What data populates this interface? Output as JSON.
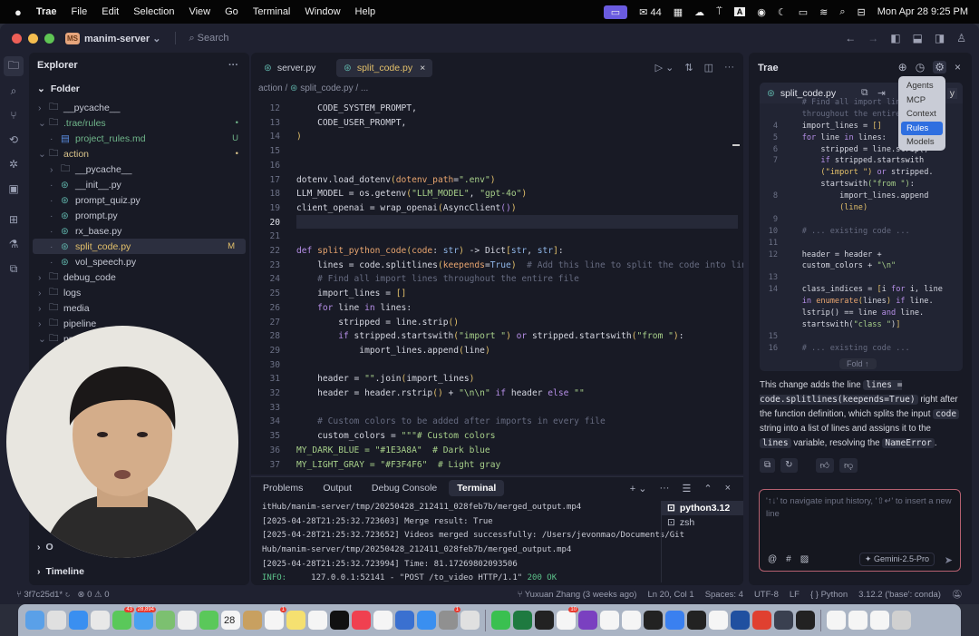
{
  "menubar": {
    "app": "Trae",
    "items": [
      "File",
      "Edit",
      "Selection",
      "View",
      "Go",
      "Terminal",
      "Window",
      "Help"
    ],
    "wechat_count": "44",
    "datetime": "Mon Apr 28  9:25 PM"
  },
  "titlebar": {
    "project_initials": "MS",
    "project": "manim-server",
    "search": "Search"
  },
  "explorer": {
    "title": "Explorer",
    "root": "Folder",
    "items": [
      {
        "label": "__pycache__",
        "depth": 0,
        "type": "folder",
        "open": false
      },
      {
        "label": ".trae/rules",
        "depth": 0,
        "type": "folder",
        "open": true,
        "color": "#6fb58a",
        "badge": "•"
      },
      {
        "label": "project_rules.md",
        "depth": 1,
        "type": "md",
        "color": "#6fb58a",
        "badge": "U"
      },
      {
        "label": "action",
        "depth": 0,
        "type": "folder",
        "open": true,
        "color": "#d8c28a",
        "badge": "•"
      },
      {
        "label": "__pycache__",
        "depth": 1,
        "type": "folder",
        "open": false
      },
      {
        "label": "__init__.py",
        "depth": 1,
        "type": "py"
      },
      {
        "label": "prompt_quiz.py",
        "depth": 1,
        "type": "py"
      },
      {
        "label": "prompt.py",
        "depth": 1,
        "type": "py"
      },
      {
        "label": "rx_base.py",
        "depth": 1,
        "type": "py"
      },
      {
        "label": "split_code.py",
        "depth": 1,
        "type": "py",
        "color": "#e3c06a",
        "badge": "M",
        "selected": true
      },
      {
        "label": "vol_speech.py",
        "depth": 1,
        "type": "py"
      },
      {
        "label": "debug_code",
        "depth": 0,
        "type": "folder",
        "open": false
      },
      {
        "label": "logs",
        "depth": 0,
        "type": "folder",
        "open": false
      },
      {
        "label": "media",
        "depth": 0,
        "type": "folder",
        "open": false
      },
      {
        "label": "pipeline",
        "depth": 0,
        "type": "folder",
        "open": false
      },
      {
        "label": "pro",
        "depth": 0,
        "type": "folder",
        "open": true
      }
    ],
    "outline": "O",
    "timeline": "Timeline"
  },
  "editor": {
    "tabs": [
      {
        "label": "server.py",
        "active": false
      },
      {
        "label": "split_code.py",
        "active": true
      }
    ],
    "breadcrumb": [
      "action",
      "split_code.py",
      "..."
    ],
    "current_line": 20,
    "lines": [
      {
        "n": 12,
        "t": [
          [
            "nm",
            "    CODE_SYSTEM_PROMPT,"
          ]
        ]
      },
      {
        "n": 13,
        "t": [
          [
            "nm",
            "    CODE_USER_PROMPT,"
          ]
        ]
      },
      {
        "n": 14,
        "t": [
          [
            "br",
            ")"
          ]
        ]
      },
      {
        "n": 15,
        "t": []
      },
      {
        "n": 16,
        "t": []
      },
      {
        "n": 17,
        "t": [
          [
            "nm",
            "dotenv.load_dotenv"
          ],
          [
            "br",
            "("
          ],
          [
            "fn",
            "dotenv_path"
          ],
          [
            "nm",
            "="
          ],
          [
            "st",
            "\".env\""
          ],
          [
            "br",
            ")"
          ]
        ]
      },
      {
        "n": 18,
        "t": [
          [
            "nm",
            "LLM_MODEL = os.getenv"
          ],
          [
            "br",
            "("
          ],
          [
            "st",
            "\"LLM_MODEL\""
          ],
          [
            "nm",
            ", "
          ],
          [
            "st",
            "\"gpt-4o\""
          ],
          [
            "br",
            ")"
          ]
        ]
      },
      {
        "n": 19,
        "t": [
          [
            "nm",
            "client_openai = wrap_openai"
          ],
          [
            "br",
            "("
          ],
          [
            "nm",
            "AsyncClient"
          ],
          [
            "kw",
            "()"
          ],
          [
            "br",
            ")"
          ]
        ]
      },
      {
        "n": 20,
        "t": []
      },
      {
        "n": 21,
        "t": []
      },
      {
        "n": 22,
        "t": [
          [
            "kw",
            "def "
          ],
          [
            "fn",
            "split_python_code"
          ],
          [
            "br",
            "("
          ],
          [
            "fn",
            "code"
          ],
          [
            "nm",
            ": "
          ],
          [
            "ty",
            "str"
          ],
          [
            "br",
            ")"
          ],
          [
            "nm",
            " -> Dict"
          ],
          [
            "br",
            "["
          ],
          [
            "ty",
            "str"
          ],
          [
            "nm",
            ", "
          ],
          [
            "ty",
            "str"
          ],
          [
            "br",
            "]"
          ],
          [
            "nm",
            ":"
          ]
        ]
      },
      {
        "n": 23,
        "t": [
          [
            "nm",
            "    lines = code.splitlines"
          ],
          [
            "br",
            "("
          ],
          [
            "fn",
            "keepends"
          ],
          [
            "nm",
            "="
          ],
          [
            "ty",
            "True"
          ],
          [
            "br",
            ")"
          ],
          [
            "cm",
            "  # Add this line to split the code into lines"
          ]
        ]
      },
      {
        "n": 24,
        "t": [
          [
            "cm",
            "    # Find all import lines throughout the entire file"
          ]
        ]
      },
      {
        "n": 25,
        "t": [
          [
            "nm",
            "    import_lines = "
          ],
          [
            "br",
            "[]"
          ]
        ]
      },
      {
        "n": 26,
        "t": [
          [
            "kw",
            "    for "
          ],
          [
            "nm",
            "line "
          ],
          [
            "kw",
            "in "
          ],
          [
            "nm",
            "lines:"
          ]
        ]
      },
      {
        "n": 27,
        "t": [
          [
            "nm",
            "        stripped = line.strip"
          ],
          [
            "br",
            "()"
          ]
        ]
      },
      {
        "n": 28,
        "t": [
          [
            "kw",
            "        if "
          ],
          [
            "nm",
            "stripped.startswith"
          ],
          [
            "br",
            "("
          ],
          [
            "st",
            "\"import \""
          ],
          [
            "br",
            ")"
          ],
          [
            "kw",
            " or "
          ],
          [
            "nm",
            "stripped.startswith"
          ],
          [
            "br",
            "("
          ],
          [
            "st",
            "\"from \""
          ],
          [
            "br",
            ")"
          ],
          [
            "nm",
            ":"
          ]
        ]
      },
      {
        "n": 29,
        "t": [
          [
            "nm",
            "            import_lines.append"
          ],
          [
            "br",
            "("
          ],
          [
            "nm",
            "line"
          ],
          [
            "br",
            ")"
          ]
        ]
      },
      {
        "n": 30,
        "t": []
      },
      {
        "n": 31,
        "t": [
          [
            "nm",
            "    header = "
          ],
          [
            "st",
            "\"\""
          ],
          [
            "nm",
            ".join"
          ],
          [
            "br",
            "("
          ],
          [
            "nm",
            "import_lines"
          ],
          [
            "br",
            ")"
          ]
        ]
      },
      {
        "n": 32,
        "t": [
          [
            "nm",
            "    header = header.rstrip"
          ],
          [
            "br",
            "()"
          ],
          [
            "nm",
            " + "
          ],
          [
            "st",
            "\"\\n\\n\""
          ],
          [
            "kw",
            " if "
          ],
          [
            "nm",
            "header "
          ],
          [
            "kw",
            "else "
          ],
          [
            "st",
            "\"\""
          ]
        ]
      },
      {
        "n": 33,
        "t": []
      },
      {
        "n": 34,
        "t": [
          [
            "cm",
            "    # Custom colors to be added after imports in every file"
          ]
        ]
      },
      {
        "n": 35,
        "t": [
          [
            "nm",
            "    custom_colors = "
          ],
          [
            "st",
            "\"\"\"# Custom colors"
          ]
        ]
      },
      {
        "n": 36,
        "t": [
          [
            "st",
            "MY_DARK_BLUE = \"#1E3A8A\"  # Dark blue"
          ]
        ]
      },
      {
        "n": 37,
        "t": [
          [
            "st",
            "MY_LIGHT_GRAY = \"#F3F4F6\"  # Light gray"
          ]
        ]
      }
    ]
  },
  "terminal": {
    "tabs": [
      "Problems",
      "Output",
      "Debug Console",
      "Terminal"
    ],
    "active_tab": "Terminal",
    "lines": [
      "itHub/manim-server/tmp/20250428_212411_028feb7b/merged_output.mp4",
      "[2025-04-28T21:25:32.723603] Merge result: True",
      "[2025-04-28T21:25:32.723652] Videos merged successfully: /Users/jevonmao/Documents/Git",
      "Hub/manim-server/tmp/20250428_212411_028feb7b/merged_output.mp4",
      "[2025-04-28T21:25:32.723994] Time: 81.17269802093506"
    ],
    "info_prefix": "INFO:",
    "info_text": "     127.0.0.1:52141 - \"POST /to_video HTTP/1.1\" ",
    "info_status": "200 OK",
    "sessions": [
      "python3.12",
      "zsh"
    ]
  },
  "chat": {
    "title": "Trae",
    "file": "split_code.py",
    "apply_partial": "y",
    "settings_menu": [
      "Agents",
      "MCP",
      "Context",
      "Rules",
      "Models"
    ],
    "settings_menu_active": "Rules",
    "code_lines": [
      {
        "n": "",
        "t": [
          [
            "cm",
            "    # Find all import lines"
          ]
        ]
      },
      {
        "n": "",
        "t": [
          [
            "cm",
            "    throughout the entire file"
          ]
        ]
      },
      {
        "n": "4",
        "t": [
          [
            "nm",
            "    import_lines = "
          ],
          [
            "br",
            "[]"
          ]
        ]
      },
      {
        "n": "5",
        "t": [
          [
            "kw",
            "    for "
          ],
          [
            "nm",
            "line "
          ],
          [
            "kw",
            "in "
          ],
          [
            "nm",
            "lines:"
          ]
        ]
      },
      {
        "n": "6",
        "t": [
          [
            "nm",
            "        stripped = line.strip()"
          ]
        ]
      },
      {
        "n": "7",
        "t": [
          [
            "kw",
            "        if "
          ],
          [
            "nm",
            "stripped.startswith"
          ]
        ]
      },
      {
        "n": "",
        "t": [
          [
            "br",
            "        (\"import \")"
          ],
          [
            "kw",
            " or "
          ],
          [
            "nm",
            "stripped."
          ]
        ]
      },
      {
        "n": "",
        "t": [
          [
            "nm",
            "        startswith"
          ],
          [
            "st",
            "(\"from \")"
          ],
          [
            "nm",
            ":"
          ]
        ]
      },
      {
        "n": "8",
        "t": [
          [
            "nm",
            "            import_lines.append"
          ]
        ]
      },
      {
        "n": "",
        "t": [
          [
            "br",
            "            (line)"
          ]
        ]
      },
      {
        "n": "9",
        "t": []
      },
      {
        "n": "10",
        "t": [
          [
            "cm",
            "    # ... existing code ..."
          ]
        ]
      },
      {
        "n": "11",
        "t": []
      },
      {
        "n": "12",
        "t": [
          [
            "nm",
            "    header = header +"
          ]
        ]
      },
      {
        "n": "",
        "t": [
          [
            "nm",
            "    custom_colors + "
          ],
          [
            "st",
            "\"\\n\""
          ]
        ]
      },
      {
        "n": "13",
        "t": []
      },
      {
        "n": "14",
        "t": [
          [
            "nm",
            "    class_indices = "
          ],
          [
            "br",
            "["
          ],
          [
            "nm",
            "i "
          ],
          [
            "kw",
            "for "
          ],
          [
            "nm",
            "i, line"
          ]
        ]
      },
      {
        "n": "",
        "t": [
          [
            "kw",
            "    in "
          ],
          [
            "fn",
            "enumerate"
          ],
          [
            "br",
            "("
          ],
          [
            "nm",
            "lines"
          ],
          [
            "br",
            ")"
          ],
          [
            "kw",
            " if "
          ],
          [
            "nm",
            "line."
          ]
        ]
      },
      {
        "n": "",
        "t": [
          [
            "nm",
            "    lstrip() == line "
          ],
          [
            "kw",
            "and "
          ],
          [
            "nm",
            "line."
          ]
        ]
      },
      {
        "n": "",
        "t": [
          [
            "nm",
            "    startswith("
          ],
          [
            "st",
            "\"class \""
          ],
          [
            "nm",
            ")"
          ],
          [
            "br",
            "]"
          ]
        ]
      },
      {
        "n": "15",
        "t": []
      },
      {
        "n": "16",
        "t": [
          [
            "cm",
            "    # ... existing code ..."
          ]
        ]
      }
    ],
    "fold": "Fold ↑",
    "message": [
      {
        "text": "This change adds the line "
      },
      {
        "code": "lines = code.splitlines(keepends=True)"
      },
      {
        "text": " right after the function definition, which splits the input "
      },
      {
        "code": "code"
      },
      {
        "text": " string into a list of lines and assigns it to the "
      },
      {
        "code": "lines"
      },
      {
        "text": " variable, resolving the "
      },
      {
        "code": "NameError"
      },
      {
        "text": "."
      }
    ],
    "input_placeholder": "'↑↓' to navigate input history, '⇧↵' to insert a new line",
    "model": "Gemini-2.5-Pro"
  },
  "statusbar": {
    "branch": "3f7c25d1*",
    "errors": "0",
    "warnings": "0",
    "blame": "Yuxuan Zhang (3 weeks ago)",
    "position": "Ln 20, Col 1",
    "spaces": "Spaces: 4",
    "encoding": "UTF-8",
    "eol": "LF",
    "language": "Python",
    "interpreter": "3.12.2 ('base': conda)"
  },
  "dock": {
    "apps": [
      "finder",
      "launchpad",
      "safari",
      "chrome",
      "messages",
      "mail",
      "maps",
      "photos",
      "facetime",
      "calendar",
      "contacts",
      "reminders",
      "notes",
      "freeform",
      "tv",
      "music",
      "news",
      "xcode",
      "app-store",
      "settings",
      "iphone-mirroring",
      "wechat",
      "excel",
      "cursor",
      "slack",
      "github-desktop",
      "chatgpt",
      "trae",
      "terminal-app",
      "lark",
      "terminal",
      "notion",
      "word",
      "powerpoint",
      "quicktime",
      "activity-monitor",
      "doc1",
      "doc2",
      "doc3",
      "trash"
    ],
    "badges": {
      "messages": "43",
      "mail": "28,894",
      "reminders": "1",
      "settings": "1",
      "slack": "10"
    },
    "calendar_day": "28",
    "calendar_month": "APR"
  }
}
